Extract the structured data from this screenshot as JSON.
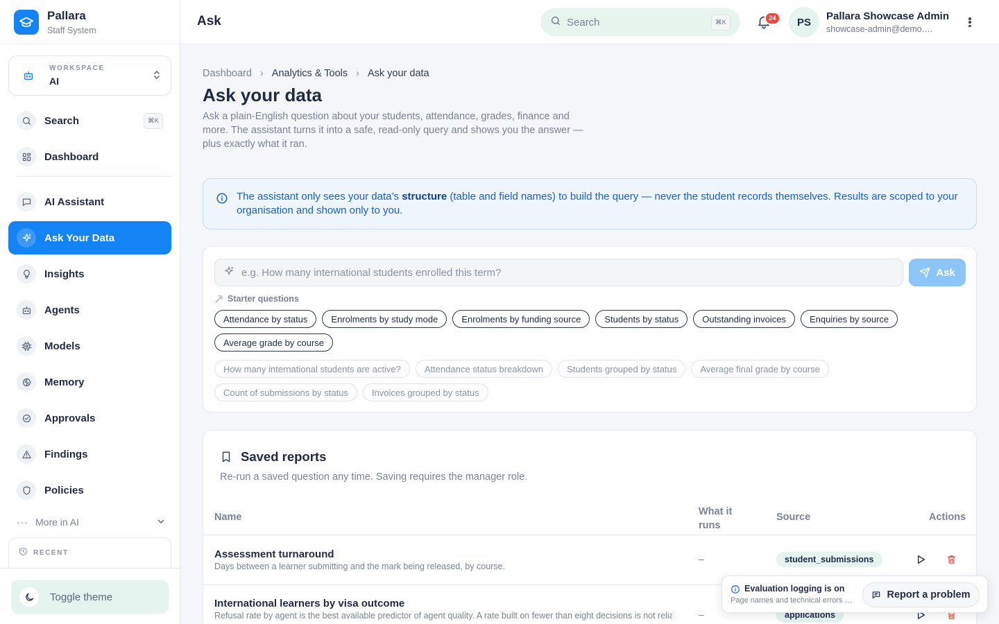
{
  "brand": {
    "name": "Pallara",
    "subtitle": "Staff System"
  },
  "workspace": {
    "label": "WORKSPACE",
    "value": "AI"
  },
  "sidebar": {
    "search": {
      "label": "Search",
      "shortcut": "⌘K"
    },
    "items": [
      {
        "label": "Dashboard",
        "icon": "grid-icon"
      },
      {
        "label": "AI Assistant",
        "icon": "chat-icon"
      },
      {
        "label": "Ask Your Data",
        "icon": "sparkle-icon",
        "active": true
      },
      {
        "label": "Insights",
        "icon": "lightbulb-icon"
      },
      {
        "label": "Agents",
        "icon": "robot-icon"
      },
      {
        "label": "Models",
        "icon": "chip-icon"
      },
      {
        "label": "Memory",
        "icon": "brain-icon"
      },
      {
        "label": "Approvals",
        "icon": "check-circle-icon"
      },
      {
        "label": "Findings",
        "icon": "warning-icon"
      },
      {
        "label": "Policies",
        "icon": "shield-icon"
      }
    ],
    "more": "More in AI",
    "recent": "RECENT",
    "toggle_theme": "Toggle theme"
  },
  "topbar": {
    "title": "Ask",
    "search_placeholder": "Search",
    "search_shortcut": "⌘K",
    "notifications": "24",
    "avatar_initials": "PS",
    "user_name": "Pallara Showcase Admin",
    "user_email": "showcase-admin@demo.pallara.app"
  },
  "breadcrumb": [
    "Dashboard",
    "Analytics & Tools",
    "Ask your data"
  ],
  "page": {
    "title": "Ask your data",
    "description": "Ask a plain-English question about your students, attendance, grades, finance and more. The assistant turns it into a safe, read-only query and shows you the answer — plus exactly what it ran."
  },
  "info": {
    "before": "The assistant only sees your data’s ",
    "bold": "structure",
    "after": " (table and field names) to build the query — never the student records themselves. Results are scoped to your organisation and shown only to you."
  },
  "ask": {
    "placeholder": "e.g. How many international students enrolled this term?",
    "button": "Ask",
    "starter_label": "Starter questions",
    "starters": [
      "Attendance by status",
      "Enrolments by study mode",
      "Enrolments by funding source",
      "Students by status",
      "Outstanding invoices",
      "Enquiries by source",
      "Average grade by course"
    ],
    "suggestions": [
      "How many international students are active?",
      "Attendance status breakdown",
      "Students grouped by status",
      "Average final grade by course",
      "Count of submissions by status",
      "Invoices grouped by status"
    ]
  },
  "saved": {
    "title": "Saved reports",
    "subtitle": "Re-run a saved question any time. Saving requires the manager role.",
    "columns": {
      "name": "Name",
      "runs_line1": "What it",
      "runs_line2": "runs",
      "source": "Source",
      "actions": "Actions"
    },
    "rows": [
      {
        "title": "Assessment turnaround",
        "description": "Days between a learner submitting and the mark being released, by course.",
        "runs": "–",
        "source": "student_submissions"
      },
      {
        "title": "International learners by visa outcome",
        "description": "Refusal rate by agent is the best available predictor of agent quality. A rate built on fewer than eight decisions is not reliable.",
        "runs": "–",
        "source": "applications"
      }
    ]
  },
  "toast": {
    "title": "Evaluation logging is on",
    "subtitle": "Page names and technical errors are recorded.",
    "button": "Report a problem"
  },
  "colors": {
    "accent": "#1483f5",
    "mint": "#e5f4ee",
    "info_bg": "#eef5fd",
    "danger": "#e5483f"
  }
}
